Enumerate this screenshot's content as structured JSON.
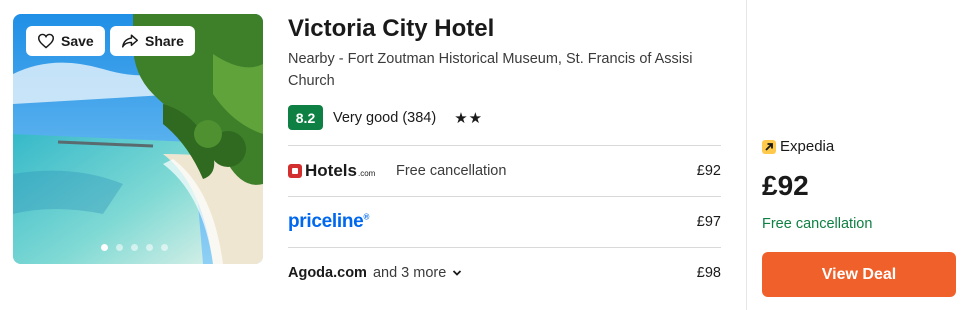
{
  "hotel": {
    "name": "Victoria City Hotel",
    "nearby": "Nearby - Fort Zoutman Historical Museum, St. Francis of Assisi Church",
    "score": "8.2",
    "rating_text": "Very good (384)",
    "stars": "★★",
    "star_count": 2
  },
  "photo": {
    "save_label": "Save",
    "share_label": "Share",
    "dot_count": 5,
    "active_dot": 0
  },
  "providers": [
    {
      "name": "Hotels",
      "suffix": ".com",
      "cancel": "Free cancellation",
      "price": "£92"
    },
    {
      "name": "priceline",
      "suffix": "®",
      "price": "£97"
    },
    {
      "name": "Agoda.com",
      "more": "and 3 more",
      "price": "£98"
    }
  ],
  "deal": {
    "provider": "Expedia",
    "price": "£92",
    "cancel": "Free cancellation",
    "button_label": "View Deal"
  },
  "colors": {
    "score_bg": "#0f8043",
    "priceline_blue": "#0068ef",
    "deal_button": "#f0602a",
    "expedia_yellow": "#ffc94c",
    "cancel_green": "#0f8043"
  }
}
